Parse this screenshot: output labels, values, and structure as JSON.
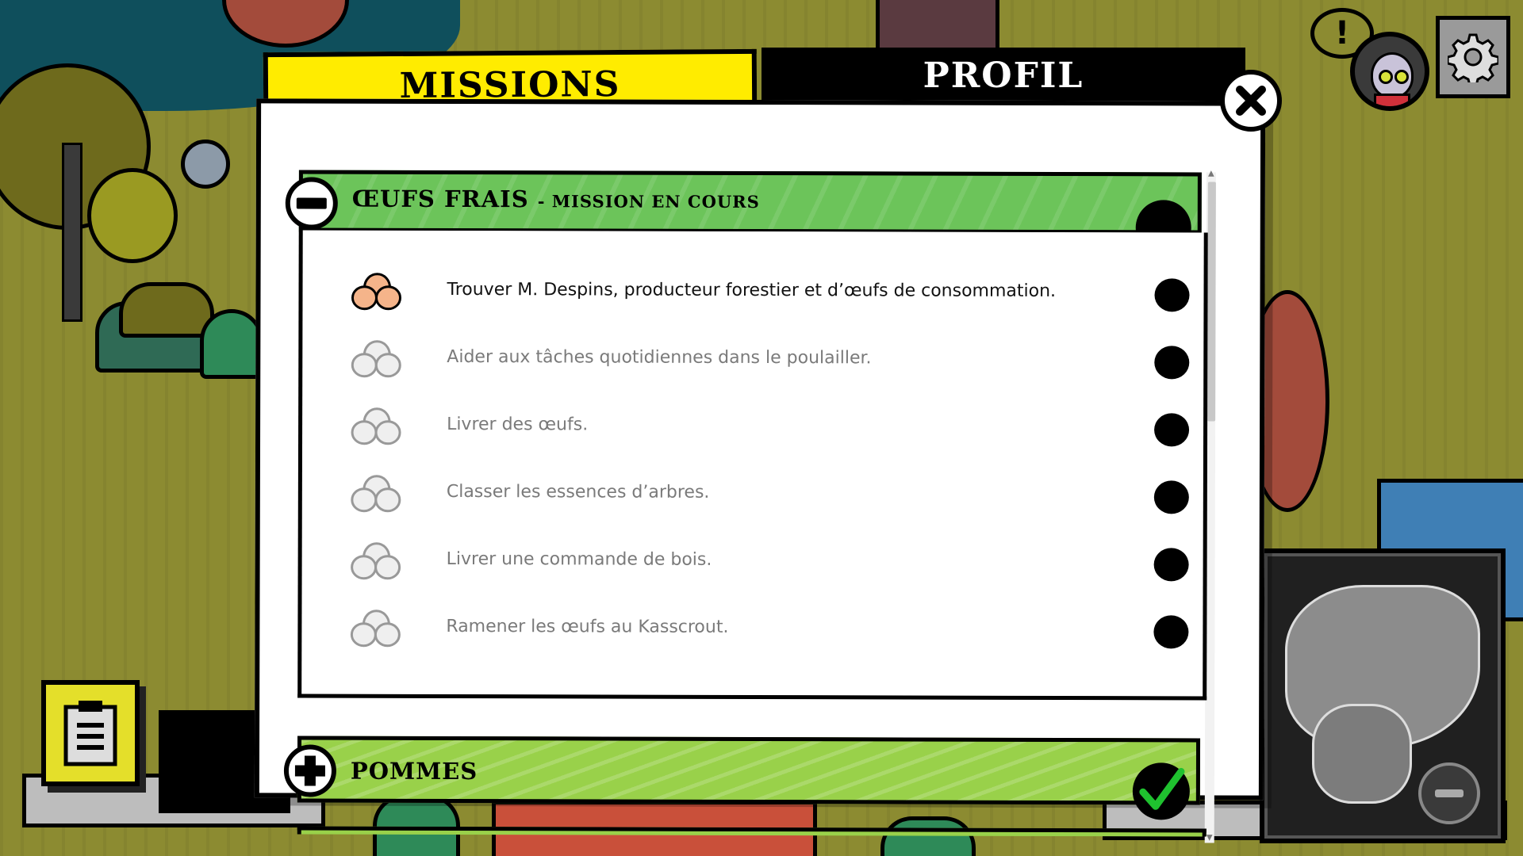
{
  "tabs": {
    "missions_label": "MISSIONS",
    "profil_label": "PROFIL",
    "active": "MISSIONS"
  },
  "hud": {
    "alert_symbol": "!",
    "icons": [
      "alert-bubble-icon",
      "avatar-icon",
      "gear-icon",
      "notes-icon",
      "close-icon",
      "minus-icon",
      "plus-icon",
      "check-icon"
    ]
  },
  "missions": [
    {
      "title": "ŒUFS FRAIS",
      "status": "- MISSION EN COURS",
      "expanded": true,
      "tasks": [
        {
          "label": "Trouver M. Despins, producteur forestier et d’œufs de consommation.",
          "active": true
        },
        {
          "label": "Aider aux tâches quotidiennes dans le poulailler.",
          "active": false
        },
        {
          "label": "Livrer des œufs.",
          "active": false
        },
        {
          "label": "Classer les essences d’arbres.",
          "active": false
        },
        {
          "label": "Livrer une commande de bois.",
          "active": false
        },
        {
          "label": "Ramener les œufs au Kasscrout.",
          "active": false
        }
      ]
    },
    {
      "title": "POMMES",
      "status": "",
      "expanded": false,
      "completed": true
    }
  ],
  "colors": {
    "tab_active": "#ffec00",
    "header_green": "#6cc45a",
    "header_lime": "#99d14a",
    "egg_active": "#f5b48a",
    "egg_inactive": "#efefef",
    "check_green": "#1fc12f"
  }
}
